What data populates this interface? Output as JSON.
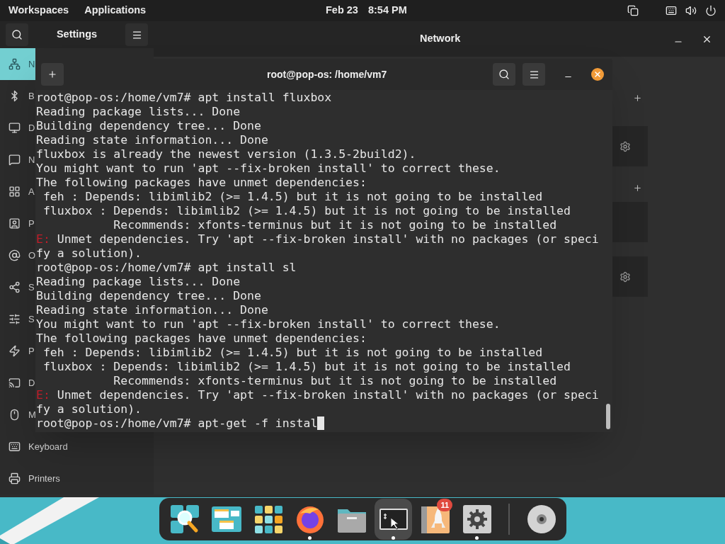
{
  "top_bar": {
    "workspaces": "Workspaces",
    "applications": "Applications",
    "date": "Feb 23",
    "time": "8:54 PM"
  },
  "settings": {
    "title": "Settings",
    "panel_title": "Network",
    "sidebar": [
      {
        "label": "N",
        "selected": true
      },
      {
        "label": "B",
        "selected": false
      },
      {
        "label": "D",
        "selected": false
      },
      {
        "label": "N",
        "selected": false
      },
      {
        "label": "A",
        "selected": false
      },
      {
        "label": "P",
        "selected": false
      },
      {
        "label": "O",
        "selected": false
      },
      {
        "label": "S",
        "selected": false
      },
      {
        "label": "S",
        "selected": false
      },
      {
        "label": "P",
        "selected": false
      },
      {
        "label": "D",
        "selected": false
      },
      {
        "label": "M",
        "selected": false
      },
      {
        "label": "Keyboard",
        "selected": false
      },
      {
        "label": "Printers",
        "selected": false
      }
    ],
    "network_items": [
      {
        "kind": "add"
      },
      {
        "kind": "settings-card"
      },
      {
        "kind": "add"
      },
      {
        "kind": "empty-card"
      },
      {
        "kind": "settings-card"
      }
    ]
  },
  "terminal": {
    "title": "root@pop-os: /home/vm7",
    "lines": [
      {
        "kind": "text",
        "text": "root@pop-os:/home/vm7# apt install fluxbox"
      },
      {
        "kind": "text",
        "text": "Reading package lists... Done"
      },
      {
        "kind": "text",
        "text": "Building dependency tree... Done"
      },
      {
        "kind": "text",
        "text": "Reading state information... Done"
      },
      {
        "kind": "text",
        "text": "fluxbox is already the newest version (1.3.5-2build2)."
      },
      {
        "kind": "text",
        "text": "You might want to run 'apt --fix-broken install' to correct these."
      },
      {
        "kind": "text",
        "text": "The following packages have unmet dependencies:"
      },
      {
        "kind": "text",
        "text": " feh : Depends: libimlib2 (>= 1.4.5) but it is not going to be installed"
      },
      {
        "kind": "text",
        "text": " fluxbox : Depends: libimlib2 (>= 1.4.5) but it is not going to be installed"
      },
      {
        "kind": "text",
        "text": "           Recommends: xfonts-terminus but it is not going to be installed"
      },
      {
        "kind": "error",
        "prefix": "E:",
        "text": " Unmet dependencies. Try 'apt --fix-broken install' with no packages (or speci"
      },
      {
        "kind": "text",
        "text": "fy a solution)."
      },
      {
        "kind": "text",
        "text": "root@pop-os:/home/vm7# apt install sl"
      },
      {
        "kind": "text",
        "text": "Reading package lists... Done"
      },
      {
        "kind": "text",
        "text": "Building dependency tree... Done"
      },
      {
        "kind": "text",
        "text": "Reading state information... Done"
      },
      {
        "kind": "text",
        "text": "You might want to run 'apt --fix-broken install' to correct these."
      },
      {
        "kind": "text",
        "text": "The following packages have unmet dependencies:"
      },
      {
        "kind": "text",
        "text": " feh : Depends: libimlib2 (>= 1.4.5) but it is not going to be installed"
      },
      {
        "kind": "text",
        "text": " fluxbox : Depends: libimlib2 (>= 1.4.5) but it is not going to be installed"
      },
      {
        "kind": "text",
        "text": "           Recommends: xfonts-terminus but it is not going to be installed"
      },
      {
        "kind": "error",
        "prefix": "E:",
        "text": " Unmet dependencies. Try 'apt --fix-broken install' with no packages (or speci"
      },
      {
        "kind": "text",
        "text": "fy a solution)."
      },
      {
        "kind": "prompt",
        "text": "root@pop-os:/home/vm7# apt-get -f instal"
      }
    ]
  },
  "dock": [
    {
      "running": false,
      "selected": false
    },
    {
      "running": false,
      "selected": false
    },
    {
      "running": false,
      "selected": false
    },
    {
      "running": true,
      "selected": false
    },
    {
      "running": false,
      "selected": false
    },
    {
      "running": true,
      "selected": true
    },
    {
      "running": false,
      "selected": false,
      "badge": "11"
    },
    {
      "running": true,
      "selected": false
    },
    {
      "kind": "separator"
    },
    {
      "running": false,
      "selected": false
    }
  ]
}
